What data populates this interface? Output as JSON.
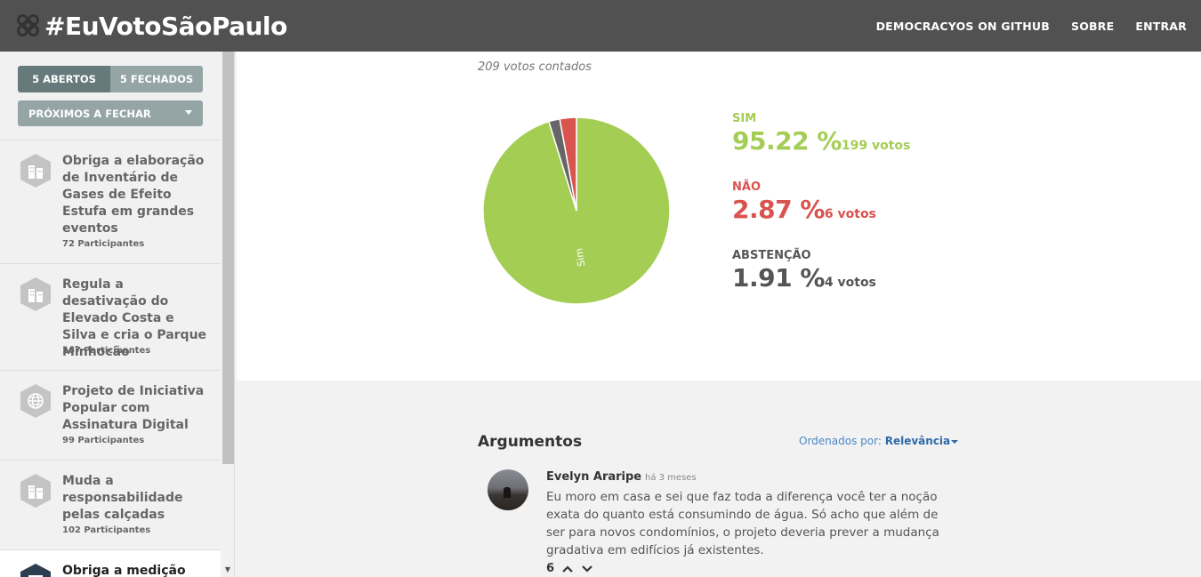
{
  "header": {
    "logo_text": "#EuVotoSãoPaulo",
    "nav": [
      "DEMOCRACYOS ON GITHUB",
      "SOBRE",
      "ENTRAR"
    ]
  },
  "sidebar": {
    "tabs": {
      "open": "5 ABERTOS",
      "closed": "5 FECHADOS"
    },
    "sort": "PRÓXIMOS A FECHAR",
    "laws": [
      {
        "title": "Obriga a elaboração de Inventário de Gases de Efeito Estufa em grandes eventos",
        "participants": "72 Participantes",
        "icon": "building-icon"
      },
      {
        "title": "Regula a desativação do Elevado Costa e Silva e cria o Parque Minhocão",
        "participants": "167 Participantes",
        "icon": "building-icon"
      },
      {
        "title": "Projeto de Iniciativa Popular com Assinatura Digital",
        "participants": "99 Participantes",
        "icon": "globe-icon"
      },
      {
        "title": "Muda a responsabilidade pelas calçadas",
        "participants": "102 Participantes",
        "icon": "building-icon"
      },
      {
        "title": "Obriga a medição",
        "participants": "",
        "icon": "building-icon"
      }
    ]
  },
  "results": {
    "votes_counted": "209 votos contados",
    "pie_label": "Sim",
    "options": [
      {
        "label": "SIM",
        "percent": "95.22 %",
        "votes": "199 votos",
        "color": "#a4cd54"
      },
      {
        "label": "NÃO",
        "percent": "2.87 %",
        "votes": "6 votos",
        "color": "#d9534f"
      },
      {
        "label": "ABSTENÇÃO",
        "percent": "1.91 %",
        "votes": "4 votos",
        "color": "#666666"
      }
    ]
  },
  "chart_data": {
    "type": "pie",
    "categories": [
      "Sim",
      "Não",
      "Abstenção"
    ],
    "values": [
      199,
      6,
      4
    ],
    "colors": [
      "#a4cd54",
      "#d9534f",
      "#666666"
    ]
  },
  "arguments": {
    "title": "Argumentos",
    "order_label": "Ordenados por:",
    "order_value": "Relevância",
    "comment": {
      "author": "Evelyn Araripe",
      "time": "há 3 meses",
      "text": "Eu moro em casa e sei que faz toda a diferença você ter a noção exata do quanto está consumindo de água. Só acho que além de ser para novos condomínios, o projeto deveria prever a mudança gradativa em edifícios já existentes.",
      "score": "6"
    }
  }
}
